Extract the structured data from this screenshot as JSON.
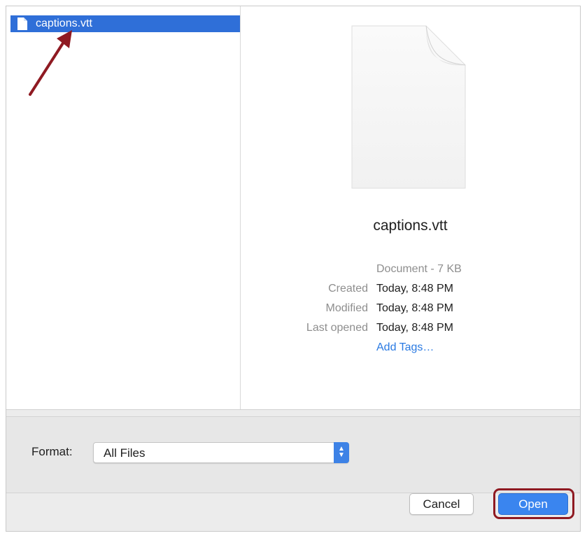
{
  "files": [
    {
      "name": "captions.vtt",
      "icon": "document-icon",
      "selected": true
    }
  ],
  "preview": {
    "file_name": "captions.vtt",
    "kind": "Document - 7 KB",
    "meta": [
      {
        "key": "Created",
        "value": "Today, 8:48 PM"
      },
      {
        "key": "Modified",
        "value": "Today, 8:48 PM"
      },
      {
        "key": "Last opened",
        "value": "Today, 8:48 PM"
      }
    ],
    "add_tags": "Add Tags…"
  },
  "format": {
    "label": "Format:",
    "selected": "All Files"
  },
  "buttons": {
    "cancel": "Cancel",
    "open": "Open"
  },
  "colors": {
    "selection": "#2f6fd8",
    "accent": "#3a85ef",
    "highlight": "#8f1a22"
  }
}
